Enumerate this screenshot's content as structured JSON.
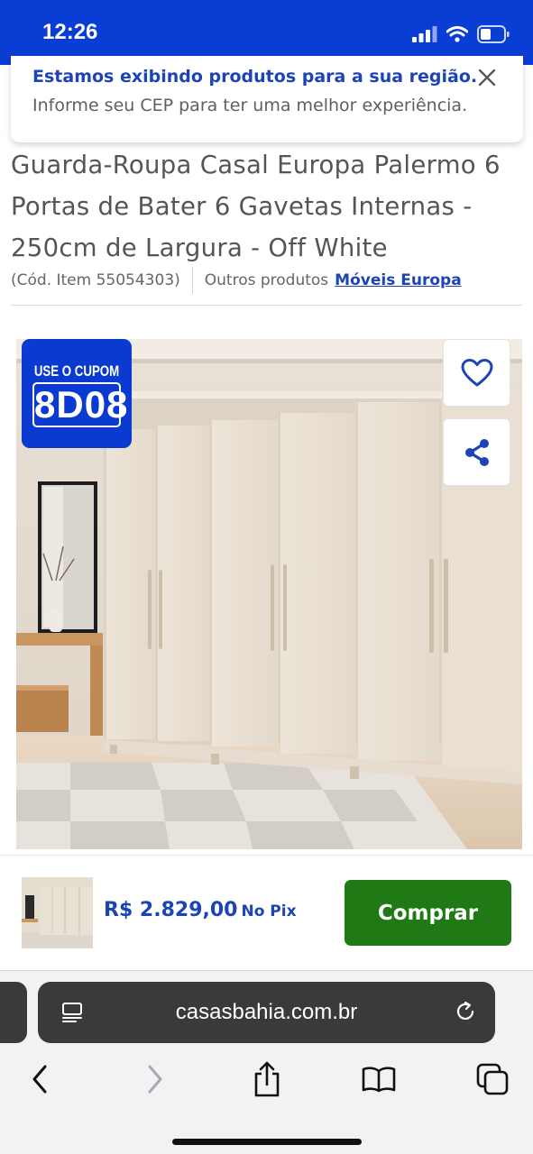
{
  "status_bar": {
    "time": "12:26",
    "icons": [
      "signal-icon",
      "wifi-icon",
      "battery-icon"
    ]
  },
  "region_banner": {
    "title": "Estamos exibindo produtos para a sua região.",
    "text": "Informe seu CEP para ter uma melhor experiência.",
    "close_icon": "close-icon"
  },
  "product": {
    "title": "Guarda-Roupa Casal Europa Palermo 6 Portas de Bater 6 Gavetas Internas - 250cm de Largura - Off White",
    "item_code": "(Cód. Item 55054303)",
    "other_products_label": "Outros produtos",
    "brand": "Móveis Europa"
  },
  "image": {
    "coupon_label": "USE O CUPOM",
    "coupon_code": "8D08",
    "favorite_icon": "heart-icon",
    "share_icon": "share-icon"
  },
  "buy_bar": {
    "price": "R$ 2.829,00",
    "price_note": "No Pix",
    "button_label": "Comprar"
  },
  "browser": {
    "url": "casasbahia.com.br",
    "toolbar": [
      "back-icon",
      "forward-icon",
      "share-icon",
      "bookmarks-icon",
      "tabs-icon"
    ]
  },
  "colors": {
    "brand_blue": "#0a3dd4",
    "link_blue": "#1d44b5",
    "buy_green": "#1f7a16"
  }
}
